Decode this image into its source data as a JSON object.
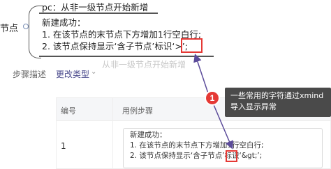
{
  "mindmap": {
    "left_label": "节点",
    "top_node": "pc：从非一级节点开始新增",
    "main_node_lines": [
      "新建成功：",
      "1. 在该节点的末节点下方增加1行空白行;",
      "2. 该节点保持显示‘含子节点’标识‘>’;"
    ],
    "faded_node": "从非一级节点开始新增"
  },
  "form": {
    "field_label": "步骤描述",
    "field_value": "更改类型",
    "field_caret": "⌄"
  },
  "table": {
    "headers": {
      "num": "编号",
      "step": "用例步骤"
    },
    "row": {
      "num": "1",
      "step_lines": [
        "新建成功：",
        "1. 在该节点的末节点下方增加1行空白行;",
        "2. 该节点保持显示‘含子节点’标识‘&gt;’;"
      ]
    }
  },
  "annotation": {
    "badge": "1",
    "text": "一些常用的字符通过xmind导入显示异常",
    "colors": {
      "highlight": "#e53935",
      "callout_bg": "#4a4a4a"
    }
  }
}
